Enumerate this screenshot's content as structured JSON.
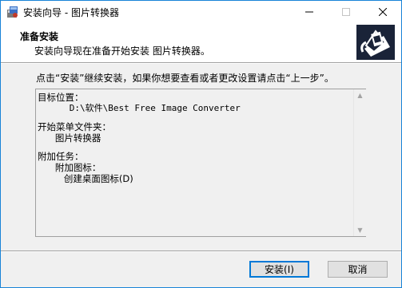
{
  "window": {
    "title": "安装向导 - 图片转换器"
  },
  "titlebar_buttons": {
    "minimize": "—",
    "maximize": "☐",
    "close": "✕"
  },
  "header": {
    "title": "准备安装",
    "subtitle": "安装向导现在准备开始安装 图片转换器。"
  },
  "instruction": "点击“安装”继续安装，如果你想要查看或者更改设置请点击“上一步”。",
  "memo": {
    "target_label": "目标位置：",
    "target_value": "      D:\\软件\\Best Free Image Converter",
    "startmenu_label": "开始菜单文件夹：",
    "startmenu_value": "      图片转换器",
    "tasks_label": "附加任务：",
    "tasks_sub_label": "      附加图标：",
    "tasks_item": "         创建桌面图标(D)"
  },
  "buttons": {
    "install": "安装(I)",
    "cancel": "取消"
  },
  "colors": {
    "accent": "#0078d7",
    "window_border": "#1883d7",
    "background": "#f0f0f0"
  }
}
